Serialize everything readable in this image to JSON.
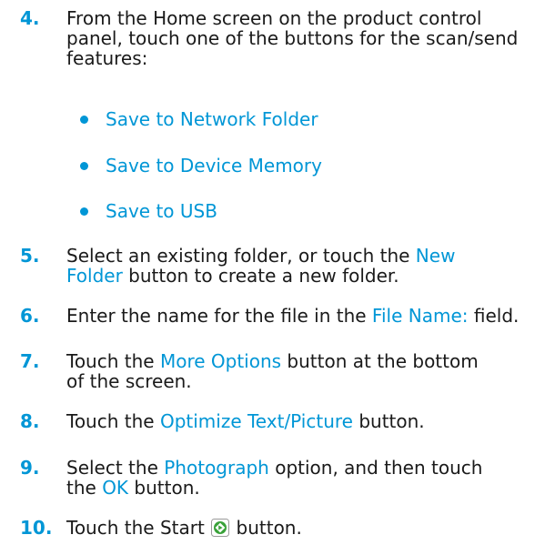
{
  "steps": [
    {
      "number": "4.",
      "text": "From the Home screen on the product control panel, touch one of the buttons for the scan/send features:",
      "options": [
        "Save to Network Folder",
        "Save to Device Memory",
        "Save to USB"
      ]
    },
    {
      "number": "5.",
      "pre": "Select an existing folder, or touch the ",
      "link": "New Folder",
      "post": " button to create a new folder."
    },
    {
      "number": "6.",
      "pre": "Enter the name for the file in the ",
      "link": "File Name:",
      "post": " field."
    },
    {
      "number": "7.",
      "pre": "Touch the ",
      "link": "More Options",
      "post": " button at the bottom of the screen."
    },
    {
      "number": "8.",
      "pre": "Touch the ",
      "link": "Optimize Text/Picture",
      "post": " button."
    },
    {
      "number": "9.",
      "pre": "Select the ",
      "link": "Photograph",
      "mid": " option, and then touch the ",
      "link2": "OK",
      "post": " button."
    },
    {
      "number": "10.",
      "pre": "Touch the Start",
      "icon": "start-button-icon",
      "post": "button."
    }
  ],
  "colors": {
    "accent": "#0096d6",
    "text": "#1a1a1a",
    "start_icon_green": "#3aa23a"
  }
}
